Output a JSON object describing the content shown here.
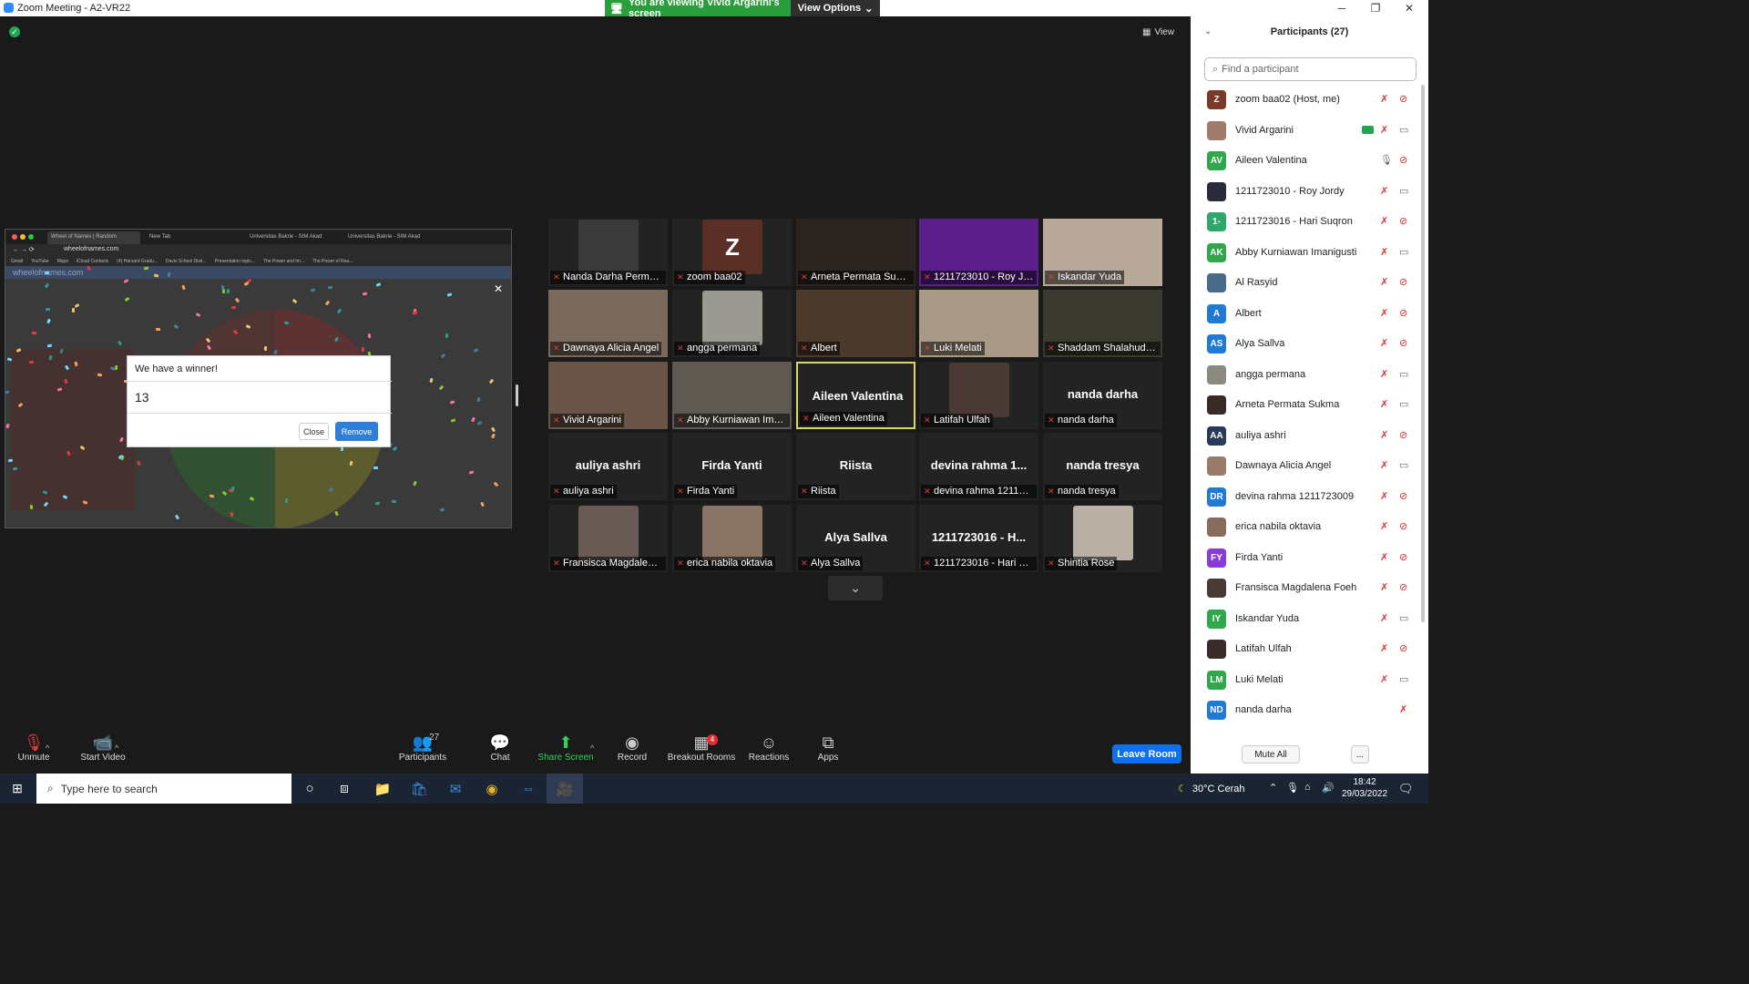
{
  "window": {
    "title": "Zoom Meeting - A2-VR22",
    "banner": "You are viewing Vivid Argarini's screen",
    "view_options": "View Options"
  },
  "meeting": {
    "view_label": "View",
    "more_icon": "chevron-down-icon"
  },
  "shared_screen": {
    "tabs": [
      "Wheel of Names | Random",
      "New Tab",
      "Universitas Bakrie - SIM Akad",
      "Universitas Bakrie - SIM Akad"
    ],
    "url": "wheelofnames.com",
    "bookmarks": [
      "Gmail",
      "YouTube",
      "Maps",
      "iCloud Contacts",
      "(4) Harvard Gradu...",
      "Davis School Distr...",
      "Presentation topic...",
      "The Power and Im...",
      "The Power of Rea..."
    ],
    "site_name": "wheelofnames.com",
    "dialog": {
      "title": "We have a winner!",
      "winner": "13",
      "close_label": "Close",
      "remove_label": "Remove"
    }
  },
  "video_tiles": [
    {
      "name": "Nanda Darha Permat...",
      "kind": "video",
      "color": "#3a3a3a"
    },
    {
      "name": "zoom baa02",
      "kind": "letter",
      "letter": "Z",
      "color": "#5a2f26"
    },
    {
      "name": "Arneta Permata Sukma",
      "kind": "video",
      "color": "#2b2420"
    },
    {
      "name": "1211723010 - Roy Jo...",
      "kind": "video",
      "color": "#5a1f8a"
    },
    {
      "name": "Iskandar Yuda",
      "kind": "video",
      "color": "#b9a99a"
    },
    {
      "name": "Dawnaya Alicia Angel",
      "kind": "video",
      "color": "#7a6a5e"
    },
    {
      "name": "angga permana",
      "kind": "video",
      "color": "#9a9a92"
    },
    {
      "name": "Albert",
      "kind": "video",
      "color": "#4a3a2c"
    },
    {
      "name": "Luki Melati",
      "kind": "video",
      "color": "#a89a86"
    },
    {
      "name": "Shaddam Shalahuddin",
      "kind": "video",
      "color": "#3a3a2e"
    },
    {
      "name": "Vivid Argarini",
      "kind": "video",
      "color": "#6a5448"
    },
    {
      "name": "Abby Kurniawan Iman...",
      "kind": "video",
      "color": "#5e5a52"
    },
    {
      "name": "Aileen Valentina",
      "kind": "name",
      "big": "Aileen Valentina"
    },
    {
      "name": "Latifah Ulfah",
      "kind": "video",
      "color": "#4a3a36"
    },
    {
      "name": "nanda darha",
      "kind": "name",
      "big": "nanda darha"
    },
    {
      "name": "auliya ashri",
      "kind": "name",
      "big": "auliya ashri"
    },
    {
      "name": "Firda Yanti",
      "kind": "name",
      "big": "Firda Yanti"
    },
    {
      "name": "Riista",
      "kind": "name",
      "big": "Riista"
    },
    {
      "name": "devina rahma 121172...",
      "kind": "name",
      "big": "devina rahma 1..."
    },
    {
      "name": "nanda tresya",
      "kind": "name",
      "big": "nanda tresya"
    },
    {
      "name": "Fransisca Magdalena...",
      "kind": "video",
      "color": "#6a5a54"
    },
    {
      "name": "erica nabila oktavia",
      "kind": "video",
      "color": "#8a7466"
    },
    {
      "name": "Alya Sallva",
      "kind": "name",
      "big": "Alya Sallva"
    },
    {
      "name": "1211723016 - Hari Su...",
      "kind": "name",
      "big": "1211723016 - H..."
    },
    {
      "name": "Shintia Rose",
      "kind": "video",
      "color": "#b8b0a4"
    }
  ],
  "toolbar": {
    "unmute": "Unmute",
    "start_video": "Start Video",
    "participants": "Participants",
    "participants_count": "27",
    "chat": "Chat",
    "share_screen": "Share Screen",
    "record": "Record",
    "breakout_rooms": "Breakout Rooms",
    "breakout_badge": "4",
    "reactions": "Reactions",
    "apps": "Apps",
    "leave": "Leave Room"
  },
  "participants_panel": {
    "title": "Participants (27)",
    "search_placeholder": "Find a participant",
    "mute_all": "Mute All",
    "more": "...",
    "items": [
      {
        "name": "zoom baa02 (Host, me)",
        "initials": "Z",
        "color": "#7a3a2a",
        "mic": "muted",
        "cam": "off"
      },
      {
        "name": "Vivid Argarini",
        "initials": "",
        "color": "#a07a6a",
        "mic": "muted",
        "cam": "on",
        "sharing": true
      },
      {
        "name": "Aileen Valentina",
        "initials": "AV",
        "color": "#2ea84a",
        "mic": "on",
        "cam": "off"
      },
      {
        "name": "1211723010 - Roy Jordy",
        "initials": "",
        "color": "#2a2a3a",
        "mic": "muted",
        "cam": "on"
      },
      {
        "name": "1211723016 - Hari Suqron",
        "initials": "1-",
        "color": "#2ea86a",
        "mic": "muted",
        "cam": "off"
      },
      {
        "name": "Abby Kurniawan Imanigusti",
        "initials": "AK",
        "color": "#2ea84a",
        "mic": "muted",
        "cam": "on"
      },
      {
        "name": "Al Rasyid",
        "initials": "",
        "color": "#4a6a8a",
        "mic": "muted",
        "cam": "off"
      },
      {
        "name": "Albert",
        "initials": "A",
        "color": "#1f7ad6",
        "mic": "muted",
        "cam": "off"
      },
      {
        "name": "Alya Sallva",
        "initials": "AS",
        "color": "#1f7ad6",
        "mic": "muted",
        "cam": "off"
      },
      {
        "name": "angga permana",
        "initials": "",
        "color": "#8a8a80",
        "mic": "muted",
        "cam": "on"
      },
      {
        "name": "Arneta Permata Sukma",
        "initials": "",
        "color": "#3a2a26",
        "mic": "muted",
        "cam": "on"
      },
      {
        "name": "auliya ashri",
        "initials": "AA",
        "color": "#2a3a5a",
        "mic": "muted",
        "cam": "off"
      },
      {
        "name": "Dawnaya Alicia Angel",
        "initials": "",
        "color": "#9a7a6a",
        "mic": "muted",
        "cam": "on"
      },
      {
        "name": "devina rahma 1211723009",
        "initials": "DR",
        "color": "#1f7ad6",
        "mic": "muted",
        "cam": "off"
      },
      {
        "name": "erica nabila oktavia",
        "initials": "",
        "color": "#8a6a5a",
        "mic": "muted",
        "cam": "off"
      },
      {
        "name": "Firda Yanti",
        "initials": "FY",
        "color": "#8a3ad6",
        "mic": "muted",
        "cam": "off"
      },
      {
        "name": "Fransisca Magdalena Foeh",
        "initials": "",
        "color": "#4a3a36",
        "mic": "muted",
        "cam": "off"
      },
      {
        "name": "Iskandar Yuda",
        "initials": "IY",
        "color": "#2ea84a",
        "mic": "muted",
        "cam": "on"
      },
      {
        "name": "Latifah Ulfah",
        "initials": "",
        "color": "#3a2a2a",
        "mic": "muted",
        "cam": "off"
      },
      {
        "name": "Luki Melati",
        "initials": "LM",
        "color": "#2ea84a",
        "mic": "muted",
        "cam": "on"
      },
      {
        "name": "nanda darha",
        "initials": "ND",
        "color": "#1f7ad6",
        "mic": "muted",
        "cam": "none"
      }
    ]
  },
  "taskbar": {
    "search_placeholder": "Type here to search",
    "weather": "30°C  Cerah",
    "time": "18:42",
    "date": "29/03/2022"
  }
}
